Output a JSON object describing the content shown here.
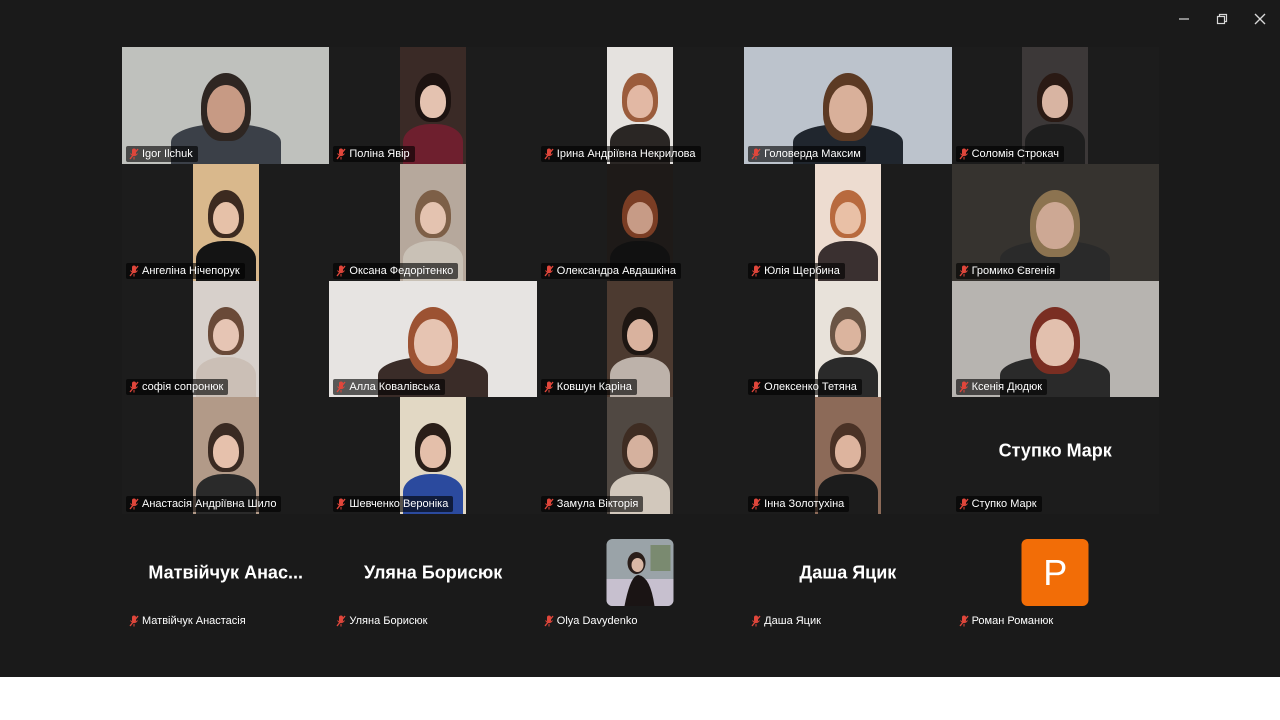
{
  "window": {
    "minimize_glyph": "—",
    "restore_glyph": "❐",
    "close_glyph": "✕"
  },
  "participants": [
    {
      "name": "Igor Ilchuk",
      "video": "wide",
      "bg": "#bfc1bd",
      "skin": "#c79a84",
      "hair": "#2e2622",
      "top": "#3b4048",
      "active": true
    },
    {
      "name": "Поліна Явір",
      "video": "narrow",
      "bg": "#3a2a26",
      "skin": "#e4c2b0",
      "hair": "#1c1210",
      "top": "#6e1f2e"
    },
    {
      "name": "Ірина Андріївна Некрилова",
      "video": "narrow",
      "bg": "#e5e2df",
      "skin": "#e2b8a4",
      "hair": "#9b5c3c",
      "top": "#2a2624"
    },
    {
      "name": "Головерда Максим",
      "video": "wide",
      "bg": "#bcc3cc",
      "skin": "#d9b09a",
      "hair": "#5c3a24",
      "top": "#20262e"
    },
    {
      "name": "Соломія Строкач",
      "video": "narrow",
      "bg": "#3c3838",
      "skin": "#d8b4a2",
      "hair": "#2a1a14",
      "top": "#1e1e1e"
    },
    {
      "name": "Ангеліна Нічепорук",
      "video": "narrow",
      "bg": "#d9b88c",
      "skin": "#e6c1a8",
      "hair": "#3c2a20",
      "top": "#141414"
    },
    {
      "name": "Оксана Федорітенко",
      "video": "narrow",
      "bg": "#b6a89c",
      "skin": "#e4c3b0",
      "hair": "#7d5f47",
      "top": "#c9c1b6"
    },
    {
      "name": "Олександра Авдашкіна",
      "video": "narrow",
      "bg": "#1e1a18",
      "skin": "#c79b86",
      "hair": "#7a3d24",
      "top": "#111111"
    },
    {
      "name": "Юлія Щербина",
      "video": "narrow",
      "bg": "#eddcd0",
      "skin": "#e9c0a6",
      "hair": "#b86a3e",
      "top": "#3a3030"
    },
    {
      "name": "Громико Євгенія",
      "video": "wide",
      "bg": "#36332f",
      "skin": "#cda894",
      "hair": "#8c7350",
      "top": "#2a2a2a"
    },
    {
      "name": "софія сопронюк",
      "video": "narrow",
      "bg": "#d7d0cb",
      "skin": "#e6c5b4",
      "hair": "#6a4a38",
      "top": "#cbbfb6"
    },
    {
      "name": "Алла Ковалівська",
      "video": "wide",
      "bg": "#e7e4e2",
      "skin": "#e6c4b2",
      "hair": "#9c5232",
      "top": "#3a2c28"
    },
    {
      "name": "Ковшун Каріна",
      "video": "narrow",
      "bg": "#4c3a30",
      "skin": "#d9b29e",
      "hair": "#1e1612",
      "top": "#bdb2aa"
    },
    {
      "name": "Олексенко Тетяна",
      "video": "narrow",
      "bg": "#e8e2da",
      "skin": "#dbb49e",
      "hair": "#6a5444",
      "top": "#2a2a2a"
    },
    {
      "name": "Ксенія Дюдюк",
      "video": "wide",
      "bg": "#b7b4b0",
      "skin": "#e2c0ae",
      "hair": "#7a2e22",
      "top": "#2a2a2a"
    },
    {
      "name": "Анастасія Андріївна Шило",
      "video": "narrow",
      "bg": "#b29a88",
      "skin": "#e6c1ac",
      "hair": "#3a2a22",
      "top": "#2a2a2a"
    },
    {
      "name": "Шевченко Вероніка",
      "video": "narrow",
      "bg": "#e2d8c4",
      "skin": "#e4bfaa",
      "hair": "#2a1e18",
      "top": "#2b4a9e"
    },
    {
      "name": "Замула Вікторія",
      "video": "narrow",
      "bg": "#504842",
      "skin": "#d5b19e",
      "hair": "#3e2c22",
      "top": "#d2c8bc"
    },
    {
      "name": "Інна Золотухіна",
      "video": "narrow",
      "bg": "#8c6a58",
      "skin": "#ddb49e",
      "hair": "#4a3226",
      "top": "#1c1c1c"
    },
    {
      "name": "Ступко Марк",
      "video": "none",
      "display": "Ступко Марк"
    }
  ],
  "bottom_row": [
    {
      "name": "Матвійчук Анастасія",
      "display": "Матвійчук  Анас...",
      "kind": "text"
    },
    {
      "name": "Уляна Борисюк",
      "display": "Уляна Борисюк",
      "kind": "text"
    },
    {
      "name": "Olya Davydenko",
      "display": "",
      "kind": "photo"
    },
    {
      "name": "Даша Яцик",
      "display": "Даша Яцик",
      "kind": "text"
    },
    {
      "name": "Роман Романюк",
      "display": "P",
      "kind": "avatar",
      "avatar_color": "#f26d07"
    }
  ],
  "colors": {
    "background": "#1a1a1a",
    "active_speaker_border": "#2bd06f",
    "mic_muted": "#e0463b"
  }
}
